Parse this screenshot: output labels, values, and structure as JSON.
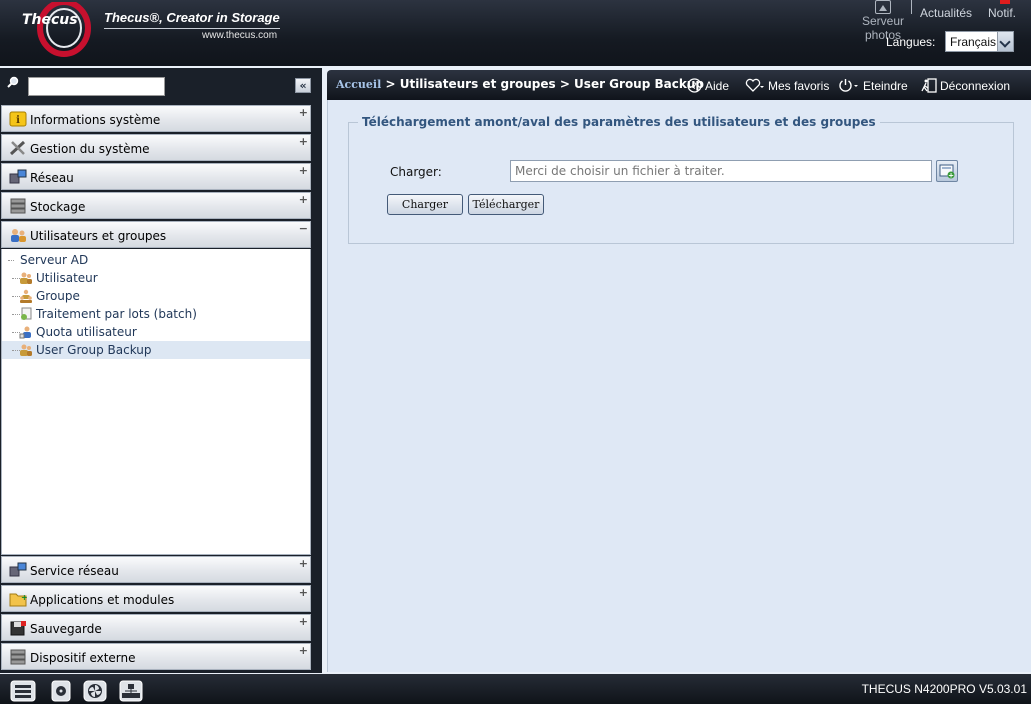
{
  "header": {
    "brand": "Thecus",
    "tagline": "Thecus®, Creator in Storage",
    "website": "www.thecus.com",
    "photo_server_label": "Serveur photos",
    "news_label": "Actualités",
    "notif_label": "Notif.",
    "language_label": "Langues:",
    "language_value": "Français"
  },
  "sidebar": {
    "search": {
      "placeholder": ""
    },
    "panels_top": [
      {
        "label": "Informations système"
      },
      {
        "label": "Gestion du système"
      },
      {
        "label": "Réseau"
      },
      {
        "label": "Stockage"
      },
      {
        "label": "Utilisateurs et groupes"
      }
    ],
    "tree": [
      {
        "label": "Serveur AD"
      },
      {
        "label": "Utilisateur"
      },
      {
        "label": "Groupe"
      },
      {
        "label": "Traitement par lots (batch)"
      },
      {
        "label": "Quota utilisateur"
      },
      {
        "label": "User Group Backup"
      }
    ],
    "panels_bottom": [
      {
        "label": "Service réseau"
      },
      {
        "label": "Applications et modules"
      },
      {
        "label": "Sauvegarde"
      },
      {
        "label": "Dispositif externe"
      }
    ]
  },
  "breadcrumb": {
    "home": "Accueil",
    "rest": " > Utilisateurs et groupes > User Group Backup"
  },
  "toolbar": {
    "help": "Aide",
    "favorites": "Mes favoris",
    "shutdown": "Eteindre",
    "logout": "Déconnexion"
  },
  "form": {
    "legend": "Téléchargement amont/aval des paramètres des utilisateurs et des groupes",
    "upload_label": "Charger:",
    "file_placeholder": "Merci de choisir un fichier à traiter.",
    "upload_button": "Charger",
    "download_button": "Télécharger"
  },
  "footer": {
    "model": "THECUS N4200PRO V5.03.01"
  }
}
